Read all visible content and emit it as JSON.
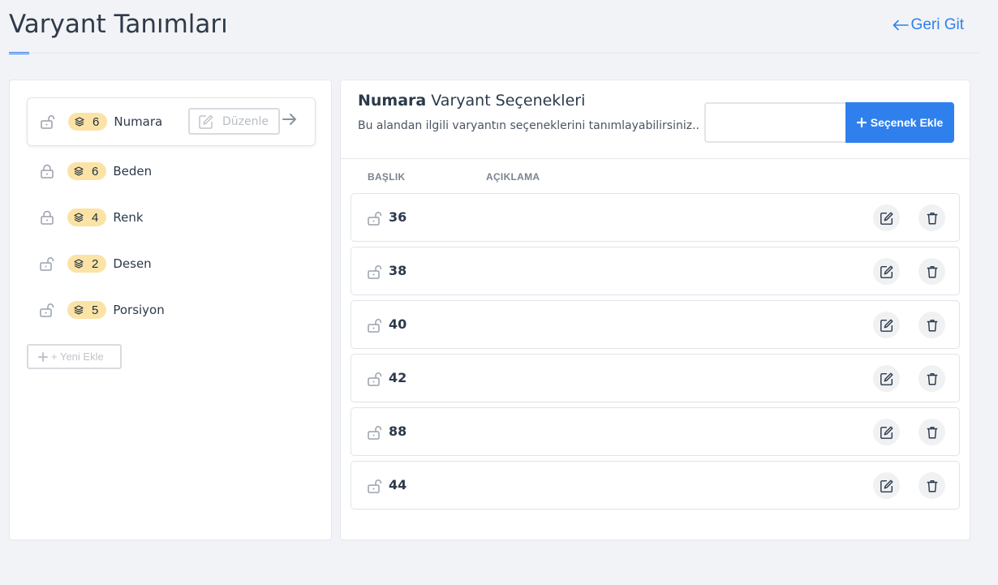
{
  "header": {
    "title": "Varyant Tanımları",
    "back_label": "Geri Git"
  },
  "variants": [
    {
      "count": "6",
      "name": "Numara",
      "locked": false,
      "active": true
    },
    {
      "count": "6",
      "name": "Beden",
      "locked": true,
      "active": false
    },
    {
      "count": "4",
      "name": "Renk",
      "locked": true,
      "active": false
    },
    {
      "count": "2",
      "name": "Desen",
      "locked": false,
      "active": false
    },
    {
      "count": "5",
      "name": "Porsiyon",
      "locked": false,
      "active": false
    }
  ],
  "edit_label": "Düzenle",
  "add_new_label": "+ Yeni Ekle",
  "options_panel": {
    "title_bold": "Numara",
    "title_rest": " Varyant Seçenekleri",
    "subtitle": "Bu alandan ilgili varyantın seçeneklerini tanımlayabilirsiniz..",
    "input_value": "",
    "input_placeholder": "",
    "add_option_label": "Seçenek Ekle",
    "columns": [
      "BAŞLIK",
      "AÇIKLAMA"
    ],
    "options": [
      {
        "title": "36",
        "description": ""
      },
      {
        "title": "38",
        "description": ""
      },
      {
        "title": "40",
        "description": ""
      },
      {
        "title": "42",
        "description": ""
      },
      {
        "title": "88",
        "description": ""
      },
      {
        "title": "44",
        "description": ""
      }
    ]
  },
  "colors": {
    "accent": "#2f80ed",
    "badge_bg": "#fbe3a6"
  },
  "icons": {
    "back": "arrow-left-icon",
    "lock_open": "lock-open-icon",
    "lock_closed": "lock-icon",
    "layers": "layers-icon",
    "edit": "edit-icon",
    "arrow": "arrow-right-icon",
    "plus": "plus-icon",
    "trash": "trash-icon"
  }
}
